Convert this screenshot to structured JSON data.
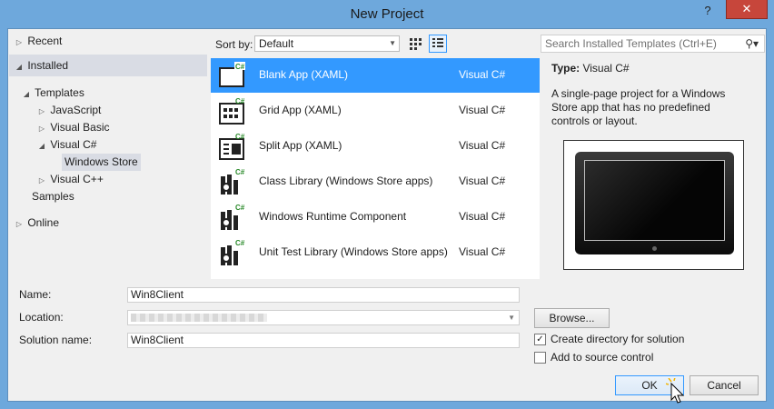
{
  "window": {
    "title": "New Project",
    "help": "?",
    "close": "✕"
  },
  "tree": {
    "recent": "Recent",
    "installed": "Installed",
    "templates": "Templates",
    "javascript": "JavaScript",
    "visual_basic": "Visual Basic",
    "visual_csharp": "Visual C#",
    "windows_store": "Windows Store",
    "visual_cpp": "Visual C++",
    "samples": "Samples",
    "online": "Online"
  },
  "toolbar": {
    "sort_label": "Sort by:",
    "sort_value": "Default",
    "search_placeholder": "Search Installed Templates (Ctrl+E)"
  },
  "templates": [
    {
      "name": "Blank App (XAML)",
      "lang": "Visual C#",
      "selected": true
    },
    {
      "name": "Grid App (XAML)",
      "lang": "Visual C#"
    },
    {
      "name": "Split App (XAML)",
      "lang": "Visual C#"
    },
    {
      "name": "Class Library (Windows Store apps)",
      "lang": "Visual C#"
    },
    {
      "name": "Windows Runtime Component",
      "lang": "Visual C#"
    },
    {
      "name": "Unit Test Library (Windows Store apps)",
      "lang": "Visual C#"
    }
  ],
  "info": {
    "type_label": "Type:",
    "type_value": "Visual C#",
    "description": "A single-page project for a Windows Store app that has no predefined controls or layout."
  },
  "form": {
    "name_label": "Name:",
    "name_value": "Win8Client",
    "location_label": "Location:",
    "solution_label": "Solution name:",
    "solution_value": "Win8Client",
    "browse": "Browse...",
    "create_dir_label": "Create directory for solution",
    "create_dir_checked": true,
    "source_control_label": "Add to source control",
    "source_control_checked": false,
    "ok": "OK",
    "cancel": "Cancel"
  },
  "colors": {
    "accent": "#3399ff",
    "titlebar": "#6ea8dc",
    "close": "#c7463b"
  }
}
